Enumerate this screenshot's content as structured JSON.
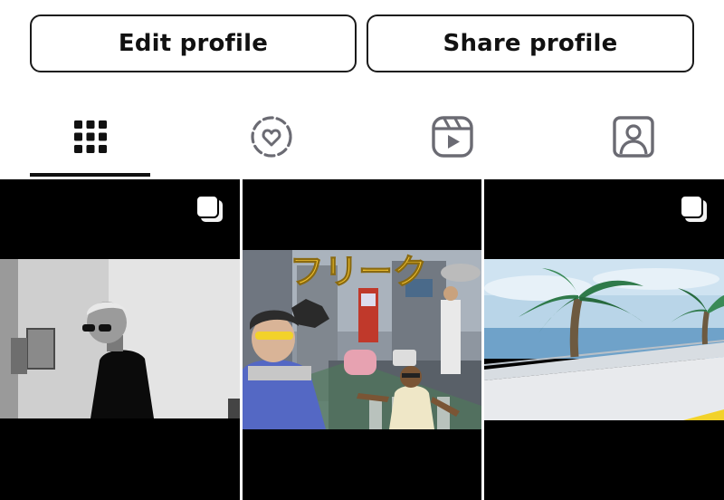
{
  "profile_actions": {
    "edit_label": "Edit profile",
    "share_label": "Share profile"
  },
  "tabs": [
    {
      "icon": "grid-icon",
      "selected": true
    },
    {
      "icon": "highlights-heart-icon",
      "selected": false
    },
    {
      "icon": "reels-icon",
      "selected": false
    },
    {
      "icon": "tagged-person-icon",
      "selected": false
    }
  ],
  "posts": [
    {
      "kind": "photo",
      "multi": true,
      "palette": "black-and-white"
    },
    {
      "kind": "collage",
      "multi": false,
      "overlay_text": "フリーク",
      "overlay_color": "#f2c230"
    },
    {
      "kind": "photo",
      "multi": true,
      "palette": "palm-trees-sky"
    }
  ],
  "colors": {
    "accent": "#111111",
    "tab_icon_inactive": "#6b6b73",
    "background": "#ffffff"
  }
}
